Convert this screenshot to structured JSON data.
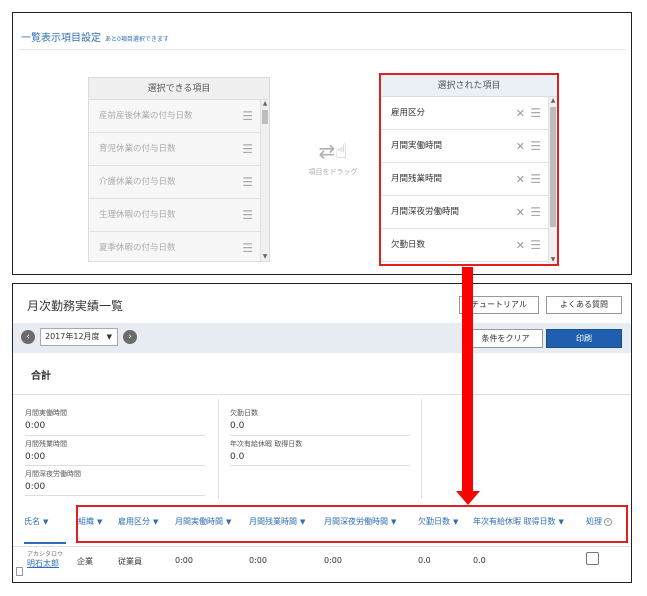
{
  "settings": {
    "title": "一覧表示項目設定",
    "subtitle": "あと0項目選択できます",
    "available": {
      "header": "選択できる項目",
      "items": [
        "産前産後休業の付与日数",
        "育児休業の付与日数",
        "介護休業の付与日数",
        "生理休暇の付与日数",
        "夏季休暇の付与日数"
      ]
    },
    "drag_label": "項目をドラッグ",
    "selected": {
      "header": "選択された項目",
      "items": [
        "雇用区分",
        "月間実働時間",
        "月間残業時間",
        "月間深夜労働時間",
        "欠勤日数"
      ]
    }
  },
  "page": {
    "title": "月次勤務実績一覧",
    "tutorial_label": "チュートリアル",
    "faq_label": "よくある質問",
    "month": "2017年12月度",
    "clear_label": "条件をクリア",
    "print_label": "印刷",
    "total_title": "合計",
    "stats": {
      "monthly_work_label": "月間実働時間",
      "monthly_work_value": "0:00",
      "overtime_label": "月間残業時間",
      "overtime_value": "0:00",
      "night_label": "月間深夜労働時間",
      "night_value": "0:00",
      "absence_label": "欠勤日数",
      "absence_value": "0.0",
      "paid_leave_label": "年次有給休暇 取得日数",
      "paid_leave_value": "0.0"
    },
    "columns": {
      "name": "氏名",
      "dept": "組織",
      "employment": "雇用区分",
      "work": "月間実働時間",
      "overtime": "月間残業時間",
      "night": "月間深夜労働時間",
      "absence": "欠勤日数",
      "paid_leave": "年次有給休暇 取得日数",
      "process": "処理"
    },
    "row": {
      "kana": "アカシタロウ",
      "name": "明石太郎",
      "dept": "企業",
      "employment": "従業員",
      "work": "0:00",
      "overtime": "0:00",
      "night": "0:00",
      "absence": "0.0",
      "paid_leave": "0.0"
    }
  },
  "icons": {
    "handle": "drag-handle-icon",
    "remove": "close-icon",
    "drag": "hand-drag-icon"
  },
  "colors": {
    "accent": "#2f6db5",
    "highlight": "#e02020",
    "primary_button": "#1f5fae"
  }
}
